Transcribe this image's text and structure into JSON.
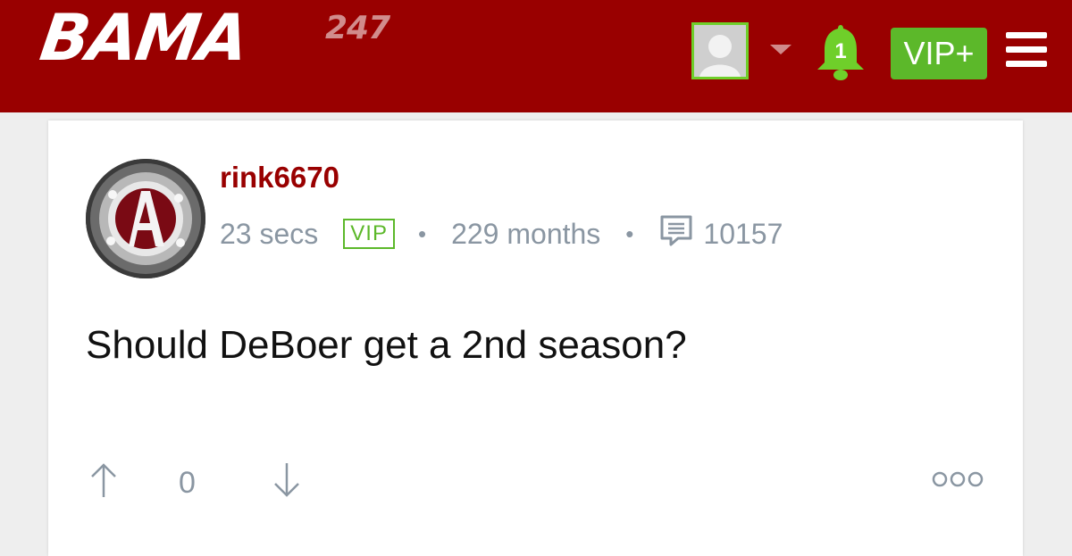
{
  "header": {
    "logo_main": "BAMA",
    "logo_sup": "247",
    "notifications_count": "1",
    "vip_label": "VIP+"
  },
  "post": {
    "username": "rink6670",
    "time_ago": "23 secs",
    "badge": "VIP",
    "separator": "•",
    "member_duration": "229 months",
    "post_count": "10157",
    "title": "Should DeBoer get a 2nd season?",
    "vote_count": "0"
  },
  "colors": {
    "brand_red": "#990000",
    "accent_green": "#5cb82a",
    "meta_gray": "#8a96a2"
  },
  "icons": {
    "menu": "hamburger-icon",
    "bell": "bell-icon",
    "comments": "comment-icon",
    "up": "arrow-up-icon",
    "down": "arrow-down-icon",
    "more": "more-icon"
  }
}
